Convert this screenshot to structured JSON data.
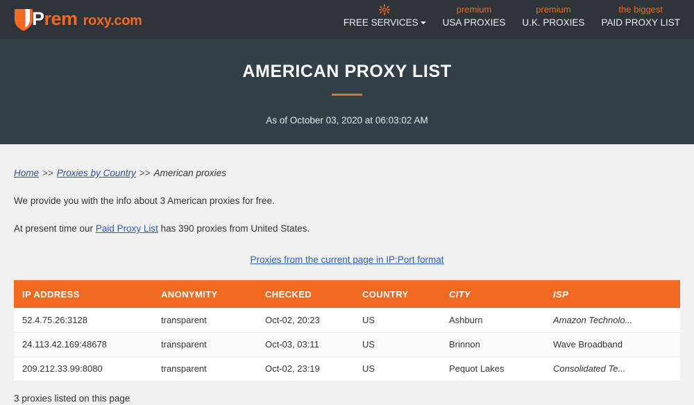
{
  "navbar": {
    "logo": {
      "shield_icon": "shield-icon",
      "line1_white": "P",
      "line1_orange": "rem",
      "line2": "roxy.com"
    },
    "items": [
      {
        "icon": "gear-icon",
        "sup": "",
        "label": "FREE SERVICES",
        "has_caret": true
      },
      {
        "icon": "",
        "sup": "premium",
        "label": "USA PROXIES",
        "has_caret": false
      },
      {
        "icon": "",
        "sup": "premium",
        "label": "U.K. PROXIES",
        "has_caret": false
      },
      {
        "icon": "",
        "sup": "the biggest",
        "label": "PAID PROXY LIST",
        "has_caret": false
      }
    ]
  },
  "hero": {
    "title": "AMERICAN PROXY LIST",
    "subtitle": "As of October 03, 2020 at 06:03:02 AM"
  },
  "breadcrumb": {
    "home": "Home",
    "sep1": ">>",
    "country": "Proxies by Country",
    "sep2": ">>",
    "current": "American proxies"
  },
  "intro": {
    "line1": "We provide you with the info about 3 American proxies for free.",
    "line2_before": "At present time our ",
    "line2_link": "Paid Proxy List",
    "line2_after": " has 390 proxies from United States."
  },
  "ipport_link": "Proxies from the current page in IP:Port format",
  "table": {
    "columns": [
      {
        "label": "IP ADDRESS",
        "italic": false
      },
      {
        "label": "ANONYMITY",
        "italic": false
      },
      {
        "label": "CHECKED",
        "italic": false
      },
      {
        "label": "COUNTRY",
        "italic": false
      },
      {
        "label": "CITY",
        "italic": true
      },
      {
        "label": "ISP",
        "italic": true
      }
    ],
    "rows": [
      {
        "ip": "52.4.75.26:3128",
        "anonymity": "transparent",
        "checked": "Oct-02, 20:23",
        "country": "US",
        "city": "Ashburn",
        "isp": "Amazon Technolo...",
        "isp_italic": true
      },
      {
        "ip": "24.113.42.169:48678",
        "anonymity": "transparent",
        "checked": "Oct-03, 03:11",
        "country": "US",
        "city": "Brinnon",
        "isp": "Wave Broadband",
        "isp_italic": false
      },
      {
        "ip": "209.212.33.99:8080",
        "anonymity": "transparent",
        "checked": "Oct-02, 23:19",
        "country": "US",
        "city": "Pequot Lakes",
        "isp": "Consolidated Te...",
        "isp_italic": true
      }
    ]
  },
  "footnote": "3 proxies listed on this page",
  "colors": {
    "navbar_bg": "#2f343a",
    "hero_bg": "#344047",
    "accent_orange": "#f26a21",
    "divider_orange": "#d3733a",
    "link_blue": "#2a5db0",
    "page_bg": "#f0f0f0"
  }
}
